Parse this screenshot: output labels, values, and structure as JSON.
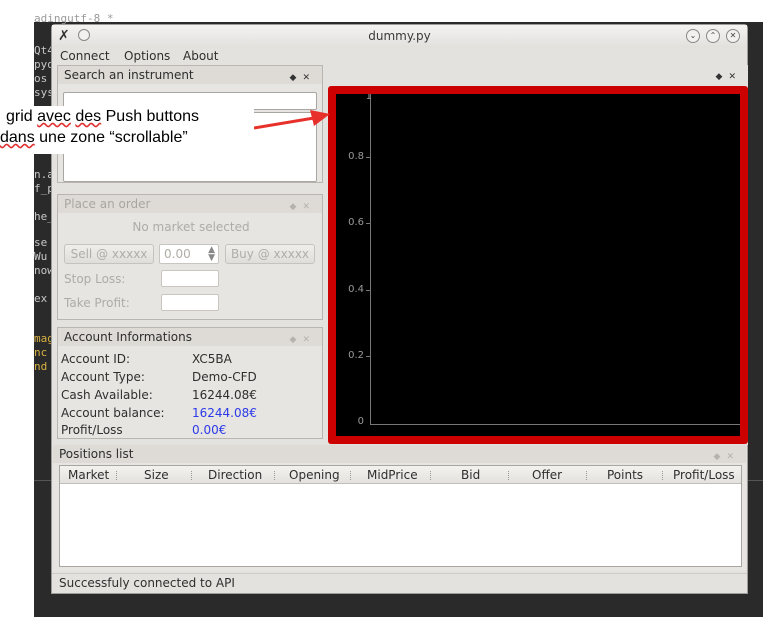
{
  "window": {
    "title": "dummy.py",
    "app_icon": "app-x-icon"
  },
  "menu": {
    "connect": "Connect",
    "options": "Options",
    "about": "About"
  },
  "search_panel": {
    "title": "Search an instrument",
    "input_value": ""
  },
  "order_panel": {
    "title": "Place an order",
    "market_status": "No market selected",
    "sell_label": "Sell @ xxxxx",
    "quantity_value": "0.00",
    "buy_label": "Buy @ xxxxx",
    "stop_loss_label": "Stop Loss:",
    "take_profit_label": "Take Profit:"
  },
  "account_panel": {
    "title": "Account Informations",
    "rows": [
      {
        "label": "Account ID:",
        "value": "XC5BA"
      },
      {
        "label": "Account Type:",
        "value": "Demo-CFD"
      },
      {
        "label": "Cash Available:",
        "value": "16244.08€"
      },
      {
        "label": "Account balance:",
        "value": "16244.08€"
      },
      {
        "label": "Profit/Loss",
        "value": "0.00€"
      }
    ],
    "highlight_color": "#2b39e8"
  },
  "plot": {
    "y_ticks": [
      "1",
      "0.8",
      "0.6",
      "0.4",
      "0.2",
      "0"
    ],
    "frame_color": "#cc0000",
    "background": "#000000"
  },
  "positions_panel": {
    "title": "Positions list",
    "columns": [
      "Market",
      "Size",
      "Direction",
      "Opening",
      "MidPrice",
      "Bid",
      "Offer",
      "Points",
      "Profit/Loss"
    ],
    "rows": []
  },
  "status_bar": {
    "text": "Successfuly connected to API"
  },
  "annotation": {
    "line1_a": "grid ",
    "line1_b": "avec",
    "line1_c": " ",
    "line1_d": "des",
    "line1_e": " Push buttons",
    "line2_a": "dans",
    "line2_b": " une zone “scrollable”",
    "arrow_color": "#e8302a"
  },
  "editor_snippets": [
    "adingutf-8 *",
    "Qt4",
    "pyq",
    "os",
    "sys",
    "n.a",
    "f_p",
    "he_",
    "se",
    "Wu",
    "now",
    "ex",
    "mag",
    "nc",
    "nd"
  ]
}
